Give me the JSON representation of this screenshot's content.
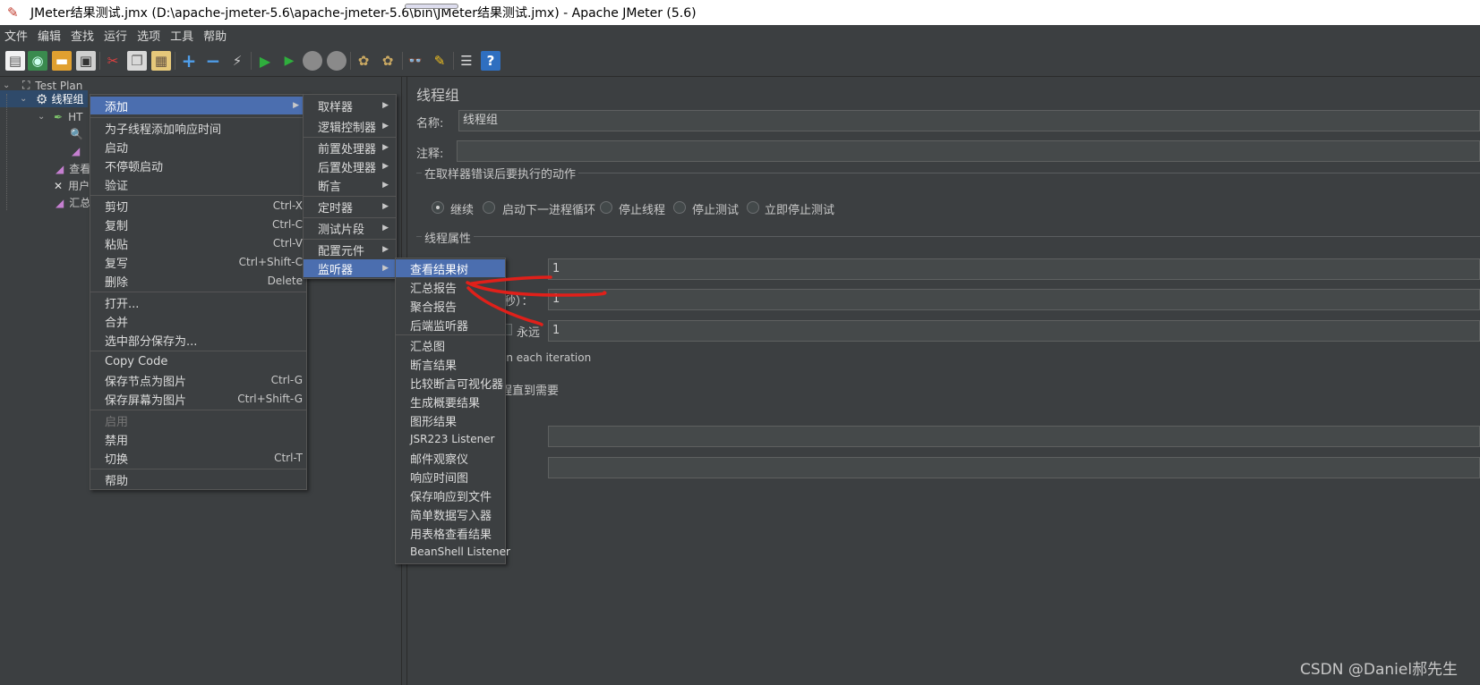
{
  "window": {
    "title": "JMeter结果测试.jmx (D:\\apache-jmeter-5.6\\apache-jmeter-5.6\\bin\\JMeter结果测试.jmx) - Apache JMeter (5.6)"
  },
  "menubar": [
    "文件",
    "编辑",
    "查找",
    "运行",
    "选项",
    "工具",
    "帮助"
  ],
  "toolbar": {
    "icons": [
      "new-icon",
      "templates-icon",
      "open-icon",
      "save-icon",
      "cut-icon",
      "copy-icon",
      "paste-icon",
      "expand-icon",
      "collapse-icon",
      "toggle-icon",
      "start-icon",
      "start-no-pauses-icon",
      "stop-icon",
      "shutdown-icon",
      "clear-icon",
      "clear-all-icon",
      "search-icon",
      "reset-search-icon",
      "function-helper-icon",
      "help-icon"
    ]
  },
  "tree": {
    "items": [
      {
        "label": "Test Plan",
        "icon": "test-plan-icon"
      },
      {
        "label": "线程组",
        "icon": "thread-group-gear-icon"
      },
      {
        "label": "HT",
        "icon": "http-sampler-icon"
      },
      {
        "label": "",
        "icon": "view-results-tree-icon"
      },
      {
        "label": "",
        "icon": "graph-listener-icon"
      },
      {
        "label": "查看",
        "icon": "graph-listener-icon"
      },
      {
        "label": "用户",
        "icon": "user-params-icon"
      },
      {
        "label": "汇总",
        "icon": "graph-listener-icon"
      }
    ]
  },
  "panel": {
    "title": "线程组",
    "name_label": "名称:",
    "name_value": "线程组",
    "comment_label": "注释:",
    "comment_value": "",
    "error_group_title": "在取样器错误后要执行的动作",
    "error_actions": [
      "继续",
      "启动下一进程循环",
      "停止线程",
      "停止测试",
      "立即停止测试"
    ],
    "selected_action": "继续",
    "thread_props_title": "线程属性",
    "threads_value": "1",
    "rampup_label_partial": "秒）：",
    "rampup_value": "1",
    "forever_label": "永远",
    "loop_value": "1",
    "same_user_partial": "on each iteration",
    "delay_partial": "程直到需要",
    "duration_value": "",
    "startup_delay_value": ""
  },
  "context_menu": {
    "items": [
      {
        "label": "添加",
        "submenu": true,
        "highlighted": true
      },
      {
        "separator": true
      },
      {
        "label": "为子线程添加响应时间"
      },
      {
        "label": "启动"
      },
      {
        "label": "不停顿启动"
      },
      {
        "label": "验证"
      },
      {
        "separator": true
      },
      {
        "label": "剪切",
        "shortcut": "Ctrl-X"
      },
      {
        "label": "复制",
        "shortcut": "Ctrl-C"
      },
      {
        "label": "粘贴",
        "shortcut": "Ctrl-V"
      },
      {
        "label": "复写",
        "shortcut": "Ctrl+Shift-C"
      },
      {
        "label": "删除",
        "shortcut": "Delete"
      },
      {
        "separator": true
      },
      {
        "label": "打开..."
      },
      {
        "label": "合并"
      },
      {
        "label": "选中部分保存为..."
      },
      {
        "separator": true
      },
      {
        "label": "Copy Code"
      },
      {
        "label": "保存节点为图片",
        "shortcut": "Ctrl-G"
      },
      {
        "label": "保存屏幕为图片",
        "shortcut": "Ctrl+Shift-G"
      },
      {
        "separator": true
      },
      {
        "label": "启用",
        "disabled": true
      },
      {
        "label": "禁用"
      },
      {
        "label": "切换",
        "shortcut": "Ctrl-T"
      },
      {
        "separator": true
      },
      {
        "label": "帮助"
      }
    ]
  },
  "add_submenu": {
    "items": [
      {
        "label": "取样器"
      },
      {
        "label": "逻辑控制器"
      },
      {
        "separator": true
      },
      {
        "label": "前置处理器"
      },
      {
        "label": "后置处理器"
      },
      {
        "label": "断言"
      },
      {
        "separator": true
      },
      {
        "label": "定时器"
      },
      {
        "separator": true
      },
      {
        "label": "测试片段"
      },
      {
        "separator": true
      },
      {
        "label": "配置元件"
      },
      {
        "label": "监听器",
        "highlighted": true
      }
    ]
  },
  "listener_submenu": {
    "items": [
      {
        "label": "查看结果树",
        "highlighted": true
      },
      {
        "label": "汇总报告"
      },
      {
        "label": "聚合报告"
      },
      {
        "label": "后端监听器"
      },
      {
        "separator": true
      },
      {
        "label": "汇总图"
      },
      {
        "label": "断言结果"
      },
      {
        "label": "比较断言可视化器"
      },
      {
        "label": "生成概要结果"
      },
      {
        "label": "图形结果"
      },
      {
        "label": "JSR223 Listener"
      },
      {
        "label": "邮件观察仪"
      },
      {
        "label": "响应时间图"
      },
      {
        "label": "保存响应到文件"
      },
      {
        "label": "简单数据写入器"
      },
      {
        "label": "用表格查看结果"
      },
      {
        "label": "BeanShell Listener"
      }
    ]
  },
  "annotation": {
    "color": "#e0201a"
  },
  "watermark": "CSDN @Daniel郝先生"
}
